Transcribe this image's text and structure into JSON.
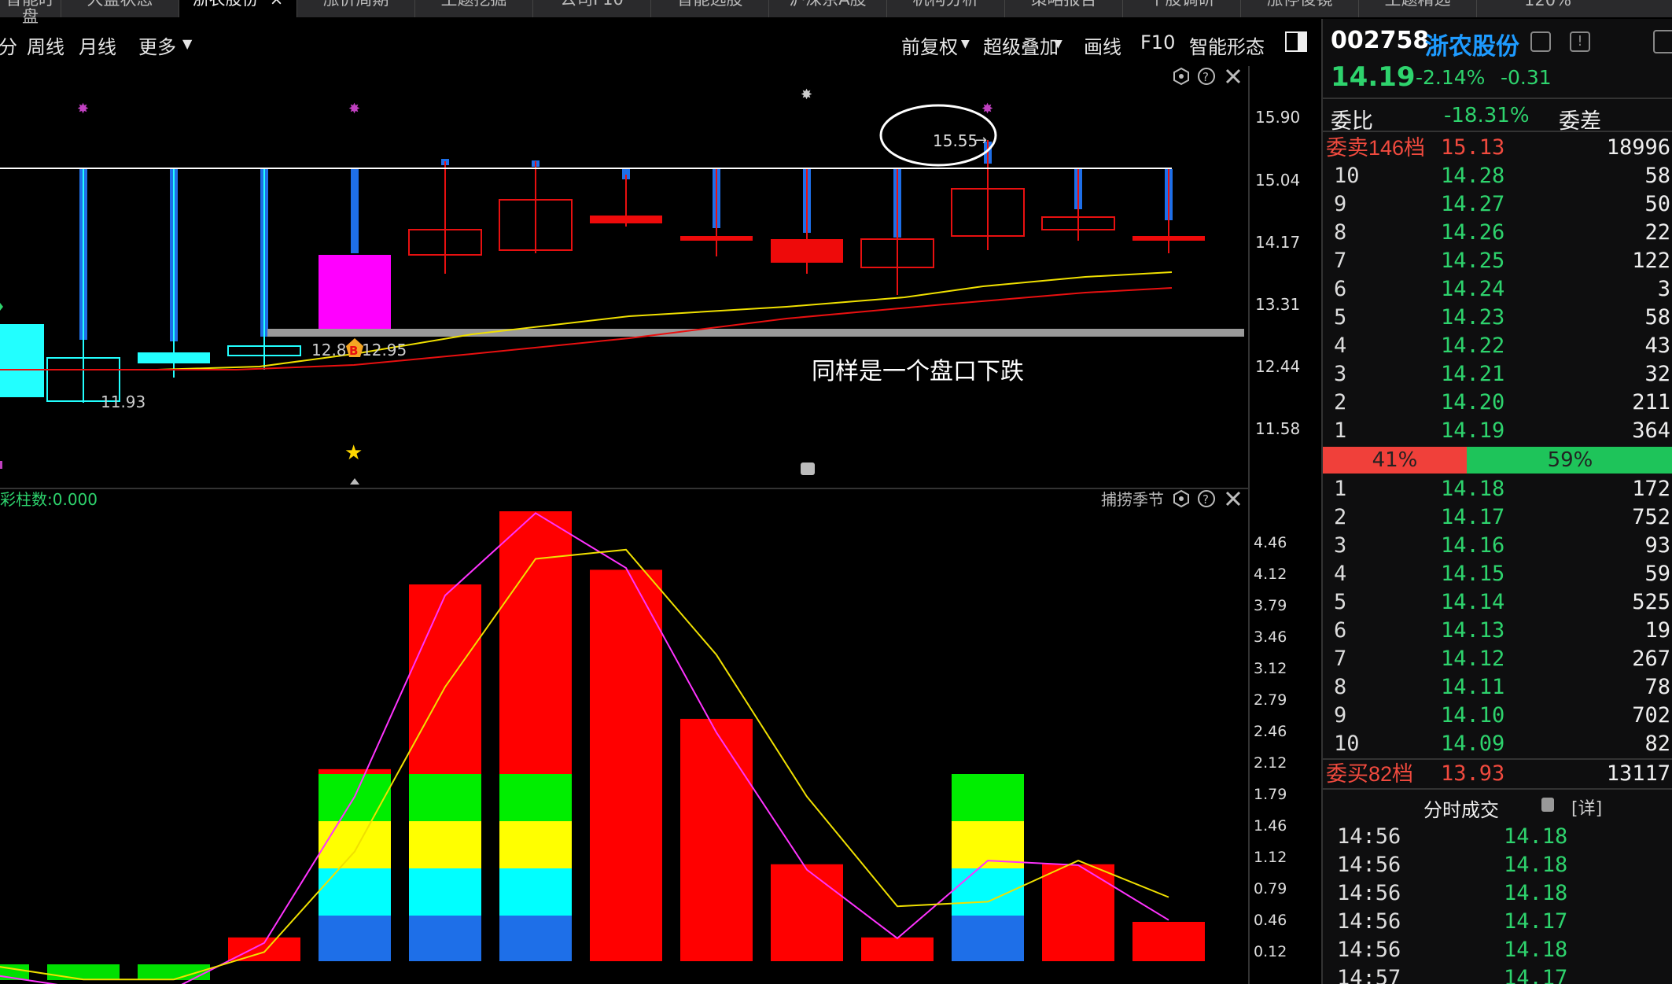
{
  "tabs": [
    "智能盯盘",
    "大盘状态",
    "浙农股份",
    "涨价周期",
    "主题挖掘",
    "公司F10",
    "智能选股",
    "沪深京A股",
    "机构分析",
    "策略报告",
    "个股调研",
    "涨停俊镜",
    "主题精选"
  ],
  "tab_active_close": "×",
  "zoom": "120%",
  "toolbar": {
    "left": [
      "分",
      "周线",
      "月线",
      "更多"
    ],
    "right": [
      "前复权",
      "超级叠加",
      "画线",
      "F10",
      "智能形态"
    ]
  },
  "stock": {
    "code": "002758",
    "name": "浙农股份",
    "price": "14.19",
    "change_pct": "-2.14%",
    "change": "-0.31"
  },
  "weibi": {
    "label": "委比",
    "value": "-18.31%",
    "label2": "委差"
  },
  "sell_header": {
    "label": "委卖146档",
    "price": "15.13",
    "vol": "18996"
  },
  "sell_levels": [
    {
      "lvl": "10",
      "price": "14.28",
      "vol": "58"
    },
    {
      "lvl": "9",
      "price": "14.27",
      "vol": "50"
    },
    {
      "lvl": "8",
      "price": "14.26",
      "vol": "22"
    },
    {
      "lvl": "7",
      "price": "14.25",
      "vol": "122"
    },
    {
      "lvl": "6",
      "price": "14.24",
      "vol": "3"
    },
    {
      "lvl": "5",
      "price": "14.23",
      "vol": "58"
    },
    {
      "lvl": "4",
      "price": "14.22",
      "vol": "43"
    },
    {
      "lvl": "3",
      "price": "14.21",
      "vol": "32"
    },
    {
      "lvl": "2",
      "price": "14.20",
      "vol": "211"
    },
    {
      "lvl": "1",
      "price": "14.19",
      "vol": "364"
    }
  ],
  "ratio": {
    "sell": "41%",
    "buy": "59%",
    "sell_fraction": 0.41
  },
  "buy_levels": [
    {
      "lvl": "1",
      "price": "14.18",
      "vol": "172"
    },
    {
      "lvl": "2",
      "price": "14.17",
      "vol": "752"
    },
    {
      "lvl": "3",
      "price": "14.16",
      "vol": "93"
    },
    {
      "lvl": "4",
      "price": "14.15",
      "vol": "59"
    },
    {
      "lvl": "5",
      "price": "14.14",
      "vol": "525"
    },
    {
      "lvl": "6",
      "price": "14.13",
      "vol": "19"
    },
    {
      "lvl": "7",
      "price": "14.12",
      "vol": "267"
    },
    {
      "lvl": "8",
      "price": "14.11",
      "vol": "78"
    },
    {
      "lvl": "9",
      "price": "14.10",
      "vol": "702"
    },
    {
      "lvl": "10",
      "price": "14.09",
      "vol": "82"
    }
  ],
  "buy_footer": {
    "label": "委买82档",
    "price": "13.93",
    "vol": "13117"
  },
  "ticks_header": {
    "title": "分时成交",
    "detail": "[详]"
  },
  "ticks": [
    {
      "time": "14:56",
      "price": "14.18"
    },
    {
      "time": "14:56",
      "price": "14.18"
    },
    {
      "time": "14:56",
      "price": "14.18"
    },
    {
      "time": "14:56",
      "price": "14.17"
    },
    {
      "time": "14:56",
      "price": "14.18"
    },
    {
      "time": "14:57",
      "price": "14.17"
    }
  ],
  "main_chart": {
    "y_ticks": [
      "15.90",
      "15.04",
      "14.17",
      "13.31",
      "12.44",
      "11.58"
    ],
    "annotation": "同样是一个盘口下跌",
    "circle_label": "15.55",
    "low_label": "11.93",
    "price_labels": [
      "12.8",
      "12.95"
    ],
    "b_marker": "B"
  },
  "sub_chart": {
    "title_left": "彩柱数:0.000",
    "title_right": "捕捞季节",
    "y_ticks": [
      "4.46",
      "4.12",
      "3.79",
      "3.46",
      "3.12",
      "2.79",
      "2.46",
      "2.12",
      "1.79",
      "1.46",
      "1.12",
      "0.79",
      "0.46",
      "0.12"
    ]
  },
  "chart_data": {
    "type": "bar",
    "bars": [
      {
        "x": 0,
        "total": -0.45
      },
      {
        "x": 1,
        "total": -0.33
      },
      {
        "x": 2,
        "total": -0.29
      },
      {
        "x": 3,
        "total": 0.26
      },
      {
        "x": 4,
        "total": 2.1
      },
      {
        "x": 5,
        "total": 4.12
      },
      {
        "x": 6,
        "total": 4.92
      },
      {
        "x": 7,
        "total": 4.28
      },
      {
        "x": 8,
        "total": 2.65
      },
      {
        "x": 9,
        "total": 1.06
      },
      {
        "x": 10,
        "total": 0.26
      },
      {
        "x": 11,
        "total": 2.02
      },
      {
        "x": 12,
        "total": 1.06
      },
      {
        "x": 13,
        "total": 0.43
      }
    ],
    "line_magenta": [
      -0.15,
      -0.3,
      -0.3,
      0.2,
      1.8,
      4.0,
      4.9,
      4.3,
      2.5,
      1.0,
      0.25,
      1.1,
      1.05,
      0.45
    ],
    "line_yellow": [
      -0.05,
      -0.2,
      -0.2,
      0.1,
      1.2,
      3.0,
      4.4,
      4.5,
      3.35,
      1.8,
      0.6,
      0.65,
      1.1,
      0.7
    ]
  }
}
